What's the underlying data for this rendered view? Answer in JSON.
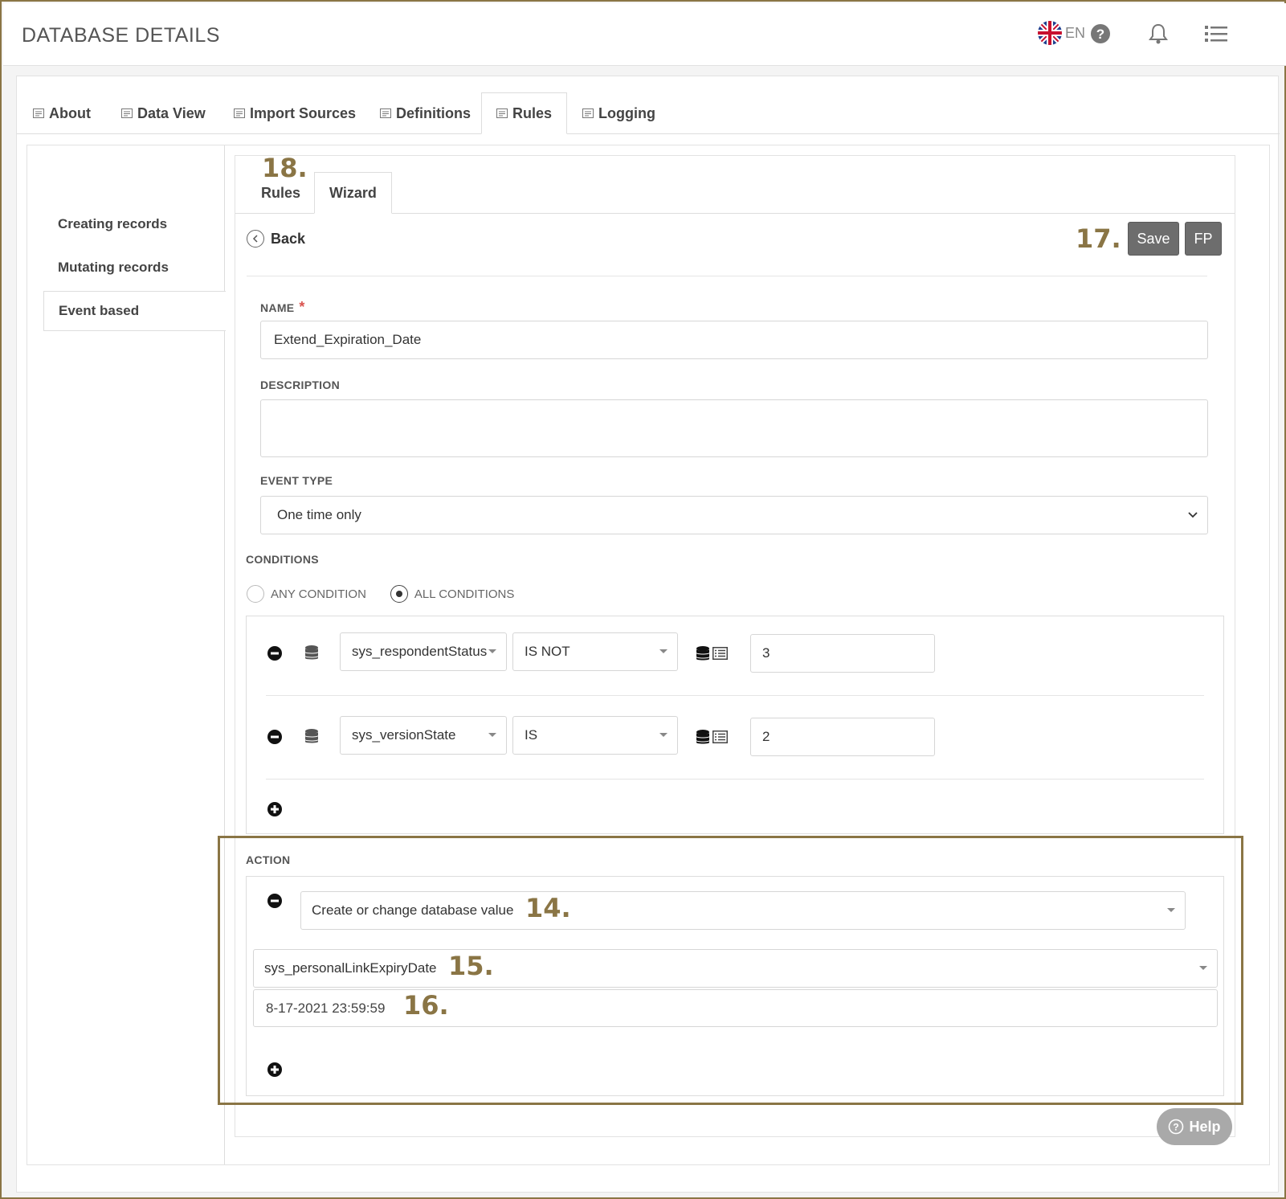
{
  "header": {
    "title": "DATABASE DETAILS",
    "language": "EN"
  },
  "main_tabs": [
    {
      "label": "About"
    },
    {
      "label": "Data View"
    },
    {
      "label": "Import Sources"
    },
    {
      "label": "Definitions"
    },
    {
      "label": "Rules"
    },
    {
      "label": "Logging"
    }
  ],
  "sidebar": {
    "items": [
      {
        "label": "Creating records"
      },
      {
        "label": "Mutating records"
      },
      {
        "label": "Event based"
      }
    ]
  },
  "inner_tabs": [
    {
      "label": "Rules"
    },
    {
      "label": "Wizard"
    }
  ],
  "annotations": {
    "a18": "18.",
    "a17": "17.",
    "a14": "14.",
    "a15": "15.",
    "a16": "16."
  },
  "toolbar": {
    "back_label": "Back",
    "save_label": "Save",
    "fp_label": "FP"
  },
  "form": {
    "name_label": "NAME",
    "name_required": "*",
    "name_value": "Extend_Expiration_Date",
    "description_label": "DESCRIPTION",
    "description_value": "",
    "event_type_label": "EVENT TYPE",
    "event_type_value": "One time only",
    "conditions_label": "CONDITIONS",
    "any_condition_label": "ANY CONDITION",
    "all_conditions_label": "ALL CONDITIONS",
    "selected_mode": "ALL CONDITIONS",
    "conditions": [
      {
        "field": "sys_respondentStatus",
        "operator": "IS NOT",
        "value": "3"
      },
      {
        "field": "sys_versionState",
        "operator": "IS",
        "value": "2"
      }
    ],
    "action_label": "ACTION",
    "action_type": "Create or change database value",
    "action_field": "sys_personalLinkExpiryDate",
    "action_value": "8-17-2021 23:59:59"
  },
  "help_label": "Help",
  "colors": {
    "accent": "#8a7545",
    "button": "#6d6d6d"
  }
}
